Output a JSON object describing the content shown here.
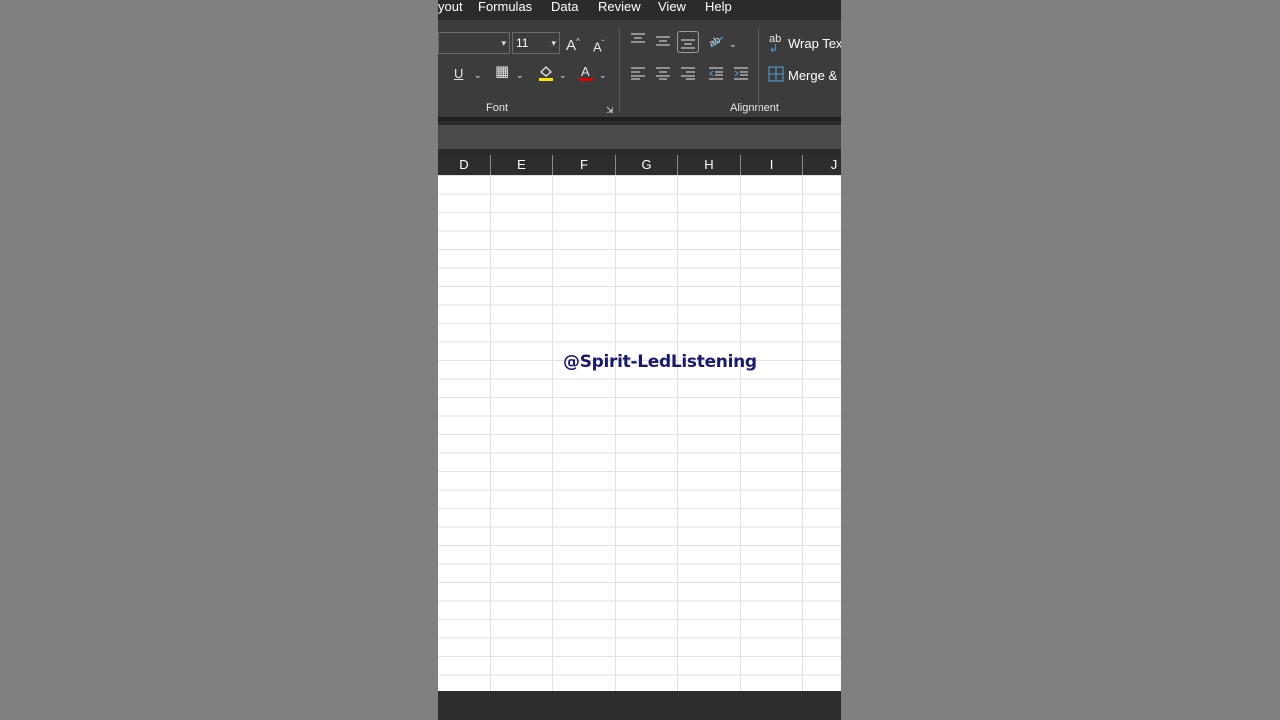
{
  "menu": {
    "items": [
      "yout",
      "Formulas",
      "Data",
      "Review",
      "View",
      "Help"
    ]
  },
  "ribbon": {
    "font_size_value": "11",
    "font_group_label": "Font",
    "alignment_group_label": "Alignment",
    "wrap_text_label": "Wrap Text",
    "merge_label": "Merge & C",
    "colors": {
      "highlight": "#ffe600",
      "font_color": "#e00000"
    }
  },
  "columns": [
    "D",
    "E",
    "F",
    "G",
    "H",
    "I",
    "J"
  ],
  "watermark": "@Spirit-LedListening"
}
